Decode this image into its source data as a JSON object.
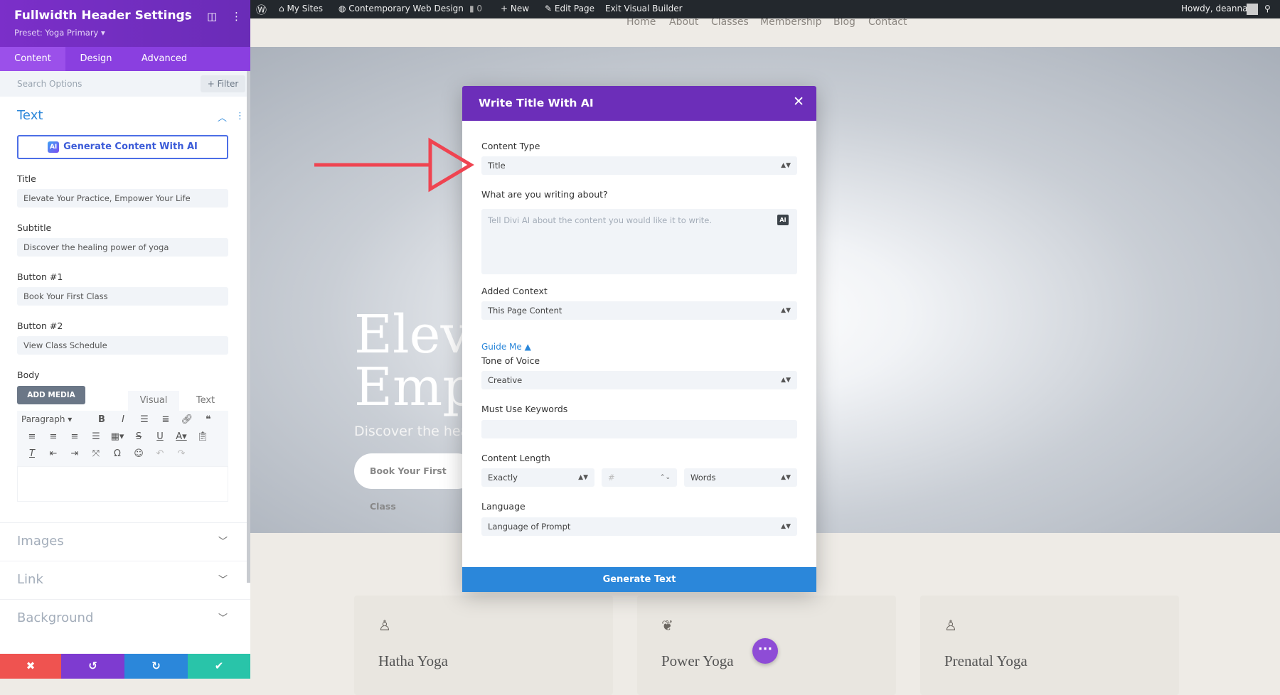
{
  "sidebar": {
    "title": "Fullwidth Header Settings",
    "preset": "Preset: Yoga Primary ▾",
    "tabs": [
      "Content",
      "Design",
      "Advanced"
    ],
    "search_placeholder": "Search Options",
    "filter_label": "+ Filter",
    "section_title": "Text",
    "generate_button": "Generate Content With AI",
    "ai_badge": "AI",
    "fields": [
      {
        "label": "Title",
        "value": "Elevate Your Practice, Empower Your Life"
      },
      {
        "label": "Subtitle",
        "value": "Discover the healing power of yoga"
      },
      {
        "label": "Button #1",
        "value": "Book Your First Class"
      },
      {
        "label": "Button #2",
        "value": "View Class Schedule"
      }
    ],
    "body_label": "Body",
    "add_media": "ADD MEDIA",
    "editor_tabs": [
      "Visual",
      "Text"
    ],
    "paragraph_select": "Paragraph",
    "accordions": [
      "Images",
      "Link",
      "Background"
    ]
  },
  "adminbar": {
    "items": [
      "My Sites",
      "Contemporary Web Design",
      "0",
      "New",
      "Edit Page",
      "Exit Visual Builder"
    ],
    "howdy": "Howdy, deanna"
  },
  "site_nav": [
    "Home",
    "About",
    "Classes",
    "Membership",
    "Blog",
    "Contact"
  ],
  "hero": {
    "line1": "Elev",
    "line2": "Emp",
    "subtitle": "Discover the healin",
    "button": "Book Your First Class"
  },
  "cards": [
    {
      "title": "Hatha Yoga",
      "icon": "kneeling-figure-icon"
    },
    {
      "title": "Power Yoga",
      "icon": "lotus-icon"
    },
    {
      "title": "Prenatal Yoga",
      "icon": "prenatal-figure-icon"
    }
  ],
  "modal": {
    "title": "Write Title With AI",
    "content_type_label": "Content Type",
    "content_type_value": "Title",
    "about_label": "What are you writing about?",
    "about_placeholder": "Tell Divi AI about the content you would like it to write.",
    "context_label": "Added Context",
    "context_value": "This Page Content",
    "guide_me": "Guide Me ▲",
    "tone_label": "Tone of Voice",
    "tone_value": "Creative",
    "keywords_label": "Must Use Keywords",
    "length_label": "Content Length",
    "length_mode": "Exactly",
    "length_number_placeholder": "#",
    "length_unit": "Words",
    "language_label": "Language",
    "language_value": "Language of Prompt",
    "generate_button": "Generate Text"
  },
  "colors": {
    "purple": "#6c2eb9",
    "blue": "#2b87da",
    "arrow": "#ef4451",
    "cancel": "#ef5350",
    "undo": "#7e3bd0",
    "redo": "#2b87da",
    "save": "#29c4a9"
  }
}
